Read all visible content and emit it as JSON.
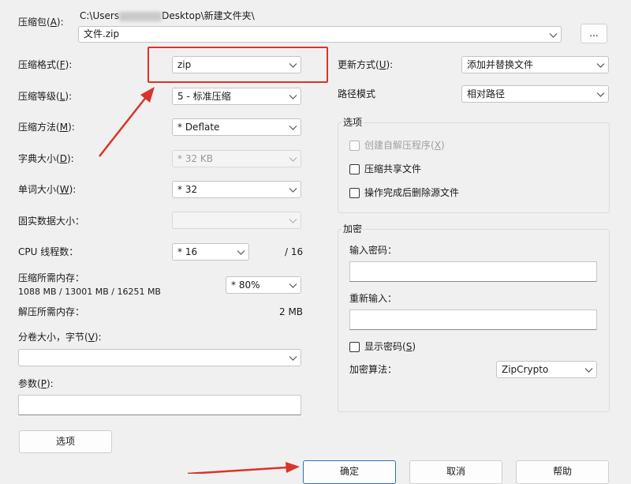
{
  "archive": {
    "label": "压缩包",
    "key": "A",
    "path_prefix": "C:\\Users",
    "path_suffix": "Desktop\\新建文件夹\\",
    "filename": "文件.zip",
    "browse_label": "..."
  },
  "left": {
    "format": {
      "label": "压缩格式",
      "key": "F",
      "value": "zip"
    },
    "level": {
      "label": "压缩等级",
      "key": "L",
      "value": "5 - 标准压缩"
    },
    "method": {
      "label": "压缩方法",
      "key": "M",
      "value": "* Deflate"
    },
    "dict": {
      "label": "字典大小",
      "key": "D",
      "value": "* 32 KB"
    },
    "word": {
      "label": "单词大小",
      "key": "W",
      "value": "* 32"
    },
    "solid": {
      "label": "固实数据大小：",
      "value": ""
    },
    "cpu": {
      "label": "CPU 线程数：",
      "value": "* 16",
      "max": "/ 16"
    },
    "mem": {
      "label": "压缩所需内存：",
      "info": "1088 MB / 13001 MB / 16251 MB",
      "value": "* 80%"
    },
    "decomp": {
      "label": "解压所需内存：",
      "value": "2 MB"
    },
    "split": {
      "label": "分卷大小，字节",
      "key": "V",
      "value": ""
    },
    "params": {
      "label": "参数",
      "key": "P",
      "value": ""
    },
    "options_button": "选项"
  },
  "right": {
    "update": {
      "label": "更新方式",
      "key": "U",
      "value": "添加并替换文件"
    },
    "path_mode": {
      "label": "路径模式",
      "value": "相对路径"
    },
    "options": {
      "title": "选项",
      "sfx": {
        "label": "创建自解压程序",
        "key": "X",
        "checked": false,
        "disabled": true
      },
      "shared": {
        "label": "压缩共享文件",
        "checked": false
      },
      "delete": {
        "label": "操作完成后删除源文件",
        "checked": false
      }
    },
    "encryption": {
      "title": "加密",
      "password_label": "输入密码：",
      "reenter_label": "重新输入：",
      "show_password": {
        "label": "显示密码",
        "key": "S",
        "checked": false
      },
      "method_label": "加密算法：",
      "method_value": "ZipCrypto"
    }
  },
  "buttons": {
    "ok": "确定",
    "cancel": "取消",
    "help": "帮助"
  },
  "colors": {
    "highlight_red": "#d9342b",
    "primary_border": "#2e6ec4"
  }
}
